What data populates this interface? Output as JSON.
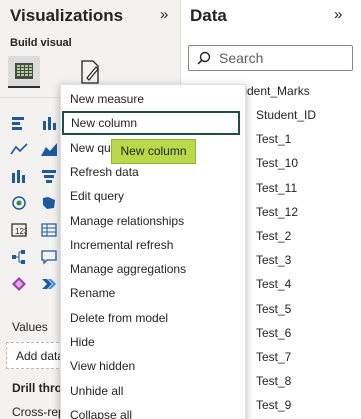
{
  "visualizations": {
    "title": "Visualizations",
    "collapse_glyph": "»",
    "build_visual_label": "Build visual",
    "values_label": "Values",
    "add_data_label": "Add data",
    "drill_through_label": "Drill through",
    "cross_report_label": "Cross-report"
  },
  "data_pane": {
    "title": "Data",
    "collapse_glyph": "»",
    "search_placeholder": "Search",
    "table_name": "Student_Marks",
    "fields": [
      {
        "name": "Student_ID",
        "sigma": false
      },
      {
        "name": "Test_1",
        "sigma": true
      },
      {
        "name": "Test_10",
        "sigma": true
      },
      {
        "name": "Test_11",
        "sigma": true
      },
      {
        "name": "Test_12",
        "sigma": true
      },
      {
        "name": "Test_2",
        "sigma": true
      },
      {
        "name": "Test_3",
        "sigma": true
      },
      {
        "name": "Test_4",
        "sigma": true
      },
      {
        "name": "Test_5",
        "sigma": true
      },
      {
        "name": "Test_6",
        "sigma": true
      },
      {
        "name": "Test_7",
        "sigma": true
      },
      {
        "name": "Test_8",
        "sigma": true
      },
      {
        "name": "Test_9",
        "sigma": true
      }
    ],
    "sigma_glyph": "∑"
  },
  "context_menu": {
    "items": [
      "New measure",
      "New column",
      "New quick measure",
      "Refresh data",
      "Edit query",
      "Manage relationships",
      "Incremental refresh",
      "Manage aggregations",
      "Rename",
      "Delete from model",
      "Hide",
      "View hidden",
      "Unhide all",
      "Collapse all"
    ],
    "focused_item": "New column"
  },
  "tooltip": {
    "text": "New column"
  },
  "colors": {
    "focus_border": "#1f4e4a",
    "tooltip_bg": "#b8d94a",
    "pane_bg": "#f3f2f1"
  }
}
